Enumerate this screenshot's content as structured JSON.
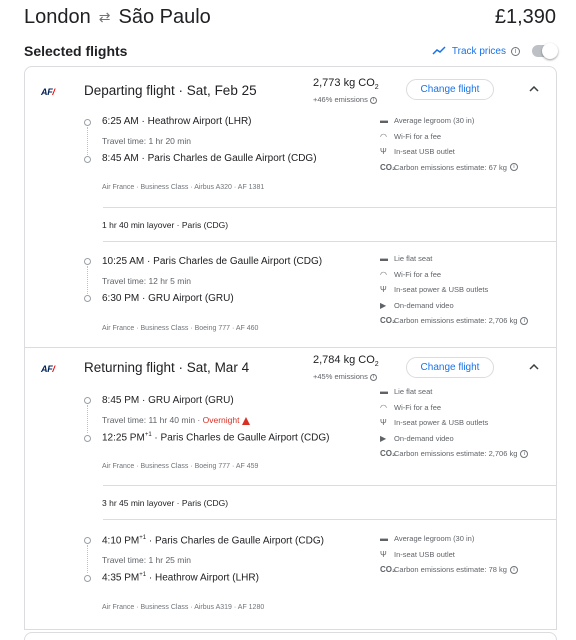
{
  "header": {
    "origin": "London",
    "destination": "São Paulo",
    "price": "£1,390"
  },
  "selected": {
    "title": "Selected flights",
    "track_label": "Track prices"
  },
  "departing": {
    "title": "Departing flight · Sat, Feb 25",
    "co2": "2,773 kg CO",
    "co2_sub": "2",
    "emissions": "+46% emissions",
    "change": "Change flight",
    "legs": [
      {
        "dep_time": "6:25 AM",
        "dep_airport": "Heathrow Airport (LHR)",
        "travel": "Travel time: 1 hr 20 min",
        "arr_time": "8:45 AM",
        "arr_airport": "Paris Charles de Gaulle Airport (CDG)",
        "meta": "Air France · Business Class · Airbus A320 · AF 1381",
        "amenities": [
          "Average legroom (30 in)",
          "Wi-Fi for a fee",
          "In-seat USB outlet",
          "Carbon emissions estimate: 67 kg"
        ]
      },
      {
        "dep_time": "10:25 AM",
        "dep_airport": "Paris Charles de Gaulle Airport (CDG)",
        "travel": "Travel time: 12 hr 5 min",
        "arr_time": "6:30 PM",
        "arr_airport": "GRU Airport (GRU)",
        "meta": "Air France · Business Class · Boeing 777 · AF 460",
        "amenities": [
          "Lie flat seat",
          "Wi-Fi for a fee",
          "In-seat power & USB outlets",
          "On-demand video",
          "Carbon emissions estimate: 2,706 kg"
        ]
      }
    ],
    "layover": "1 hr 40 min layover · Paris (CDG)"
  },
  "returning": {
    "title": "Returning flight · Sat, Mar 4",
    "co2": "2,784 kg CO",
    "co2_sub": "2",
    "emissions": "+45% emissions",
    "change": "Change flight",
    "legs": [
      {
        "dep_time": "8:45 PM",
        "dep_airport": "GRU Airport (GRU)",
        "travel": "Travel time: 11 hr 40 min",
        "overnight": "Overnight",
        "arr_time": "12:25 PM",
        "arr_sup": "+1",
        "arr_airport": "Paris Charles de Gaulle Airport (CDG)",
        "meta": "Air France · Business Class · Boeing 777 · AF 459",
        "amenities": [
          "Lie flat seat",
          "Wi-Fi for a fee",
          "In-seat power & USB outlets",
          "On-demand video",
          "Carbon emissions estimate: 2,706 kg"
        ]
      },
      {
        "dep_time": "4:10 PM",
        "dep_sup": "+1",
        "dep_airport": "Paris Charles de Gaulle Airport (CDG)",
        "travel": "Travel time: 1 hr 25 min",
        "arr_time": "4:35 PM",
        "arr_sup": "+1",
        "arr_airport": "Heathrow Airport (LHR)",
        "meta": "Air France · Business Class · Airbus A319 · AF 1280",
        "amenities": [
          "Average legroom (30 in)",
          "In-seat USB outlet",
          "Carbon emissions estimate: 78 kg"
        ]
      }
    ],
    "layover": "3 hr 45 min layover · Paris (CDG)"
  },
  "airline_logo": {
    "text": "AF",
    "stripe": "/"
  },
  "colors": {
    "accent": "#1a73e8",
    "warning": "#d93025",
    "border": "#dadce0"
  }
}
